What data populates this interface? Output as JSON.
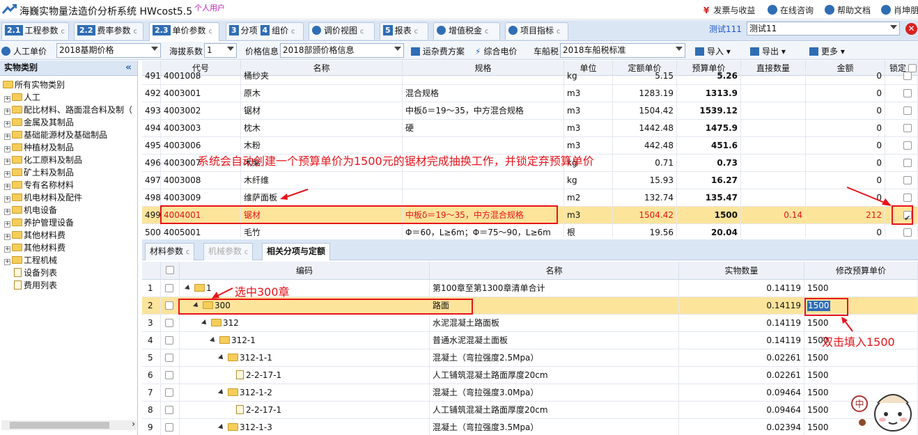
{
  "app": {
    "title": "海巍实物量法造价分析系统 HWcost5.5",
    "user_type": "个人用户"
  },
  "top_right": {
    "tax_revenue": "发票与收益",
    "online_consult": "在线咨询",
    "help_docs": "帮助文档",
    "user": "肖坤朋"
  },
  "tabs": [
    {
      "num": "2.1",
      "label": "工程参数",
      "suffix": "c"
    },
    {
      "num": "2.2",
      "label": "费率参数",
      "suffix": "c"
    },
    {
      "num": "2.3",
      "label": "单价参数",
      "suffix": "c"
    },
    {
      "num": "3",
      "label": "分项",
      "num2": "4",
      "label2": "组价",
      "suffix": "c"
    },
    {
      "label": "调价视图",
      "suffix": "c"
    },
    {
      "num": "5",
      "label": "报表",
      "suffix": "c"
    },
    {
      "label": "增值税金",
      "suffix": "c"
    },
    {
      "label": "项目指标",
      "suffix": "c"
    }
  ],
  "project": {
    "label": "测试111",
    "value": "测试11"
  },
  "toolbar": {
    "labor_price_label": "人工单价",
    "labor_price_value": "2018基期价格",
    "altitude_label": "海拔系数",
    "altitude_value": "1",
    "price_info_label": "价格信息",
    "price_info_value": "2018部颁价格信息",
    "transport_plan": "运杂费方案",
    "combined_power": "综合电价",
    "vehicle_tax_label": "车船税",
    "vehicle_tax_value": "2018车船税标准",
    "import": "导入",
    "export": "导出",
    "more": "更多"
  },
  "sidebar": {
    "title": "实物类别",
    "collapse": "«",
    "root": "所有实物类别",
    "items": [
      {
        "label": "人工"
      },
      {
        "label": "配比材料、路面混合料及制（"
      },
      {
        "label": "金属及其制品"
      },
      {
        "label": "基础能源材及基础制品"
      },
      {
        "label": "种植材及制品"
      },
      {
        "label": "化工原料及制品"
      },
      {
        "label": "矿土料及制品"
      },
      {
        "label": "专有名称材料"
      },
      {
        "label": "机电材料及配件"
      },
      {
        "label": "机电设备"
      },
      {
        "label": "养护管理设备"
      },
      {
        "label": "其他材料费"
      },
      {
        "label": "其他材料费"
      },
      {
        "label": "工程机械"
      },
      {
        "label": "设备列表",
        "leaf": true
      },
      {
        "label": "费用列表",
        "leaf": true
      }
    ],
    "scroll_arrow": "›"
  },
  "grid1": {
    "headers": [
      "代号",
      "名称",
      "规格",
      "单位",
      "定额单价",
      "预算单价",
      "直接数量",
      "金额",
      "锁定"
    ],
    "rows": [
      {
        "no": "491",
        "code": "4001008",
        "name": "桶纱夹",
        "spec": "",
        "unit": "kg",
        "quota": "5.15",
        "budget": "5.26",
        "qty": "",
        "amount": "0",
        "locked": false
      },
      {
        "no": "492",
        "code": "4003001",
        "name": "原木",
        "spec": "混合规格",
        "unit": "m3",
        "quota": "1283.19",
        "budget": "1313.9",
        "qty": "",
        "amount": "0",
        "locked": false
      },
      {
        "no": "493",
        "code": "4003002",
        "name": "锯材",
        "spec": "中板δ＝19～35，中方混合规格",
        "unit": "m3",
        "quota": "1504.42",
        "budget": "1539.12",
        "qty": "",
        "amount": "0",
        "locked": false
      },
      {
        "no": "494",
        "code": "4003003",
        "name": "枕木",
        "spec": "硬",
        "unit": "m3",
        "quota": "1442.48",
        "budget": "1475.9",
        "qty": "",
        "amount": "0",
        "locked": false
      },
      {
        "no": "495",
        "code": "4003006",
        "name": "木粉",
        "spec": "",
        "unit": "m3",
        "quota": "442.48",
        "budget": "451.6",
        "qty": "",
        "amount": "0",
        "locked": false
      },
      {
        "no": "496",
        "code": "4003007",
        "name": "木柴",
        "spec": "",
        "unit": "kg",
        "quota": "0.71",
        "budget": "0.73",
        "qty": "",
        "amount": "0",
        "locked": false
      },
      {
        "no": "497",
        "code": "4003008",
        "name": "木纤维",
        "spec": "",
        "unit": "kg",
        "quota": "15.93",
        "budget": "16.27",
        "qty": "",
        "amount": "0",
        "locked": false
      },
      {
        "no": "498",
        "code": "4003009",
        "name": "维萨面板",
        "spec": "",
        "unit": "m2",
        "quota": "132.74",
        "budget": "135.47",
        "qty": "",
        "amount": "0",
        "locked": false
      },
      {
        "no": "499",
        "code": "4004001",
        "name": "锯材",
        "spec": "中板δ＝19～35，中方混合规格",
        "unit": "m3",
        "quota": "1504.42",
        "budget": "1500",
        "qty": "0.14",
        "amount": "212",
        "locked": true
      },
      {
        "no": "500",
        "code": "4005001",
        "name": "毛竹",
        "spec": "Φ＝60，L≥6m；Φ＝75～90，L≥6m",
        "unit": "根",
        "quota": "19.56",
        "budget": "20.04",
        "qty": "",
        "amount": "0",
        "locked": false
      }
    ]
  },
  "annotations": {
    "auto_create": "系统会自动创建一个预算单价为1500元的锯材完成抽换工作，并锁定弃预算单价",
    "select_300": "选中300章",
    "double_click": "双击填入1500"
  },
  "tabs2": [
    {
      "label": "材料参数",
      "suffix": "c"
    },
    {
      "label": "机械参数",
      "suffix": "c"
    },
    {
      "label": "相关分项与定额"
    }
  ],
  "grid2": {
    "headers": [
      "编码",
      "名称",
      "实物数量",
      "修改预算单价"
    ],
    "rows": [
      {
        "no": "1",
        "code": "1",
        "name": "第100章至第1300章清单合计",
        "qty": "0.14119",
        "price": "1500",
        "type": "folder",
        "indent": 0
      },
      {
        "no": "2",
        "code": "300",
        "name": "路面",
        "qty": "0.14119",
        "price": "1500",
        "type": "folder",
        "indent": 1
      },
      {
        "no": "3",
        "code": "312",
        "name": "水泥混凝土路面板",
        "qty": "0.14119",
        "price": "1500",
        "type": "folder",
        "indent": 2
      },
      {
        "no": "4",
        "code": "312-1",
        "name": "普通水泥混凝土面板",
        "qty": "0.14119",
        "price": "1500",
        "type": "folder",
        "indent": 3
      },
      {
        "no": "5",
        "code": "312-1-1",
        "name": "混凝土（弯拉强度2.5Mpa）",
        "qty": "0.02261",
        "price": "1500",
        "type": "folder",
        "indent": 4
      },
      {
        "no": "6",
        "code": "2-2-17-1",
        "name": "人工铺筑混凝土路面厚度20cm",
        "qty": "0.02261",
        "price": "1500",
        "type": "doc",
        "indent": 5
      },
      {
        "no": "7",
        "code": "312-1-2",
        "name": "混凝土（弯拉强度3.0Mpa）",
        "qty": "0.09464",
        "price": "1500",
        "type": "folder",
        "indent": 4
      },
      {
        "no": "8",
        "code": "2-2-17-1",
        "name": "人工铺筑混凝土路面厚度20cm",
        "qty": "0.09464",
        "price": "1500",
        "type": "doc",
        "indent": 5
      },
      {
        "no": "9",
        "code": "312-1-3",
        "name": "混凝土（弯拉强度3.5Mpa）",
        "qty": "0.02394",
        "price": "1500",
        "type": "folder",
        "indent": 4
      }
    ]
  },
  "mascot": {
    "badge": "中"
  },
  "colors": {
    "accent": "#2f6db5",
    "highlight_row": "#fde49b",
    "annotation": "#e8131b",
    "tab_bg": "#dbe6f5"
  }
}
